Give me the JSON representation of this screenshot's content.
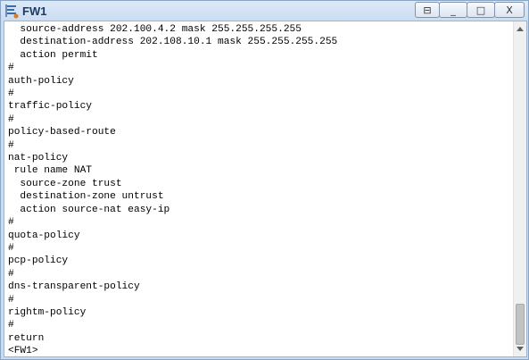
{
  "window": {
    "title": "FW1",
    "controls": {
      "restore": "⊟",
      "minimize": "_",
      "maximize": "□",
      "close": "X"
    }
  },
  "console": {
    "lines": [
      "  source-address 202.100.4.2 mask 255.255.255.255",
      "  destination-address 202.108.10.1 mask 255.255.255.255",
      "  action permit",
      "#",
      "auth-policy",
      "#",
      "traffic-policy",
      "#",
      "policy-based-route",
      "#",
      "nat-policy",
      " rule name NAT",
      "  source-zone trust",
      "  destination-zone untrust",
      "  action source-nat easy-ip",
      "#",
      "quota-policy",
      "#",
      "pcp-policy",
      "#",
      "dns-transparent-policy",
      "#",
      "rightm-policy",
      "#",
      "return",
      "<FW1>"
    ]
  },
  "icons": {
    "app": "terminal-icon",
    "scroll_up": "scroll-up-arrow-icon",
    "scroll_down": "scroll-down-arrow-icon"
  }
}
